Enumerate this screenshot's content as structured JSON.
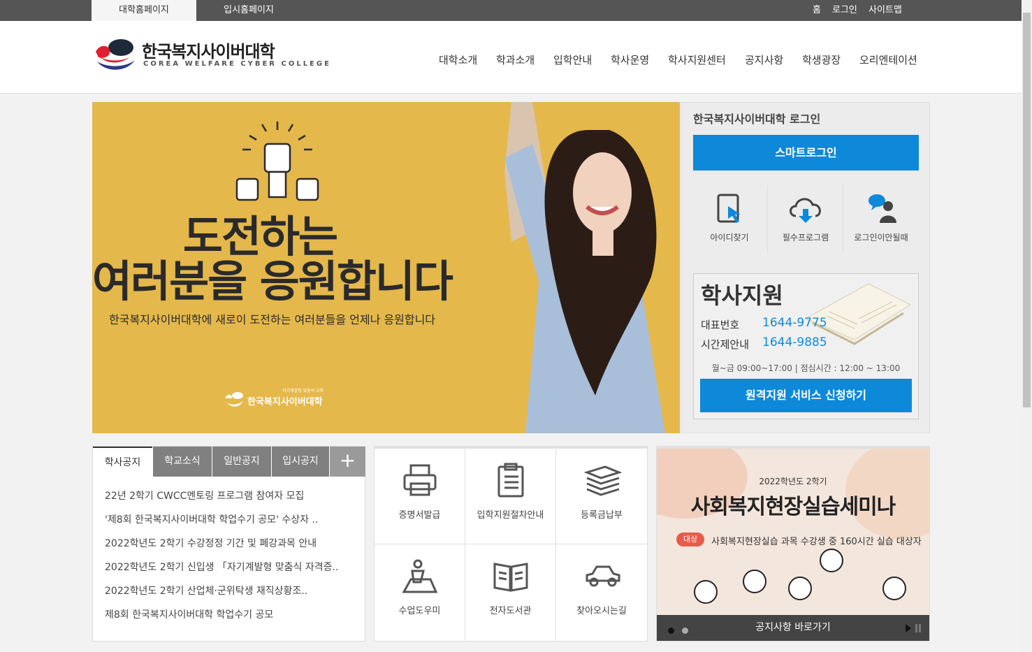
{
  "topbar": {
    "tabs": [
      "대학홈페이지",
      "입시홈페이지"
    ],
    "util": [
      "홈",
      "로그인",
      "사이트맵"
    ]
  },
  "logo": {
    "name_kr": "한국복지사이버대학",
    "name_en": "COREA WELFARE CYBER COLLEGE"
  },
  "gnb": [
    "대학소개",
    "학과소개",
    "입학안내",
    "학사운영",
    "학사지원센터",
    "공지사항",
    "학생광장",
    "오리엔테이션"
  ],
  "hero": {
    "title_line1": "도전하는",
    "title_line2": "여러분을 응원합니다",
    "subtitle": "한국복지사이버대학에 새로이 도전하는 여러분들을 언제나 응원합니다",
    "logo_small": "한국복지사이버대학",
    "logo_tag": "자기계발형 맞춤식 교육"
  },
  "login": {
    "title": "한국복지사이버대학 로그인",
    "smart_login": "스마트로그인",
    "quick": [
      {
        "label": "아이디찾기",
        "icon": "tablet-touch-icon"
      },
      {
        "label": "필수프로그램",
        "icon": "cloud-download-icon"
      },
      {
        "label": "로그인이안될때",
        "icon": "help-person-icon"
      }
    ]
  },
  "support": {
    "title": "학사지원",
    "rows": [
      {
        "label": "대표번호",
        "number": "1644-9775"
      },
      {
        "label": "시간제안내",
        "number": "1644-9885"
      }
    ],
    "hours": "월~금 09:00~17:00 | 점심시간 : 12:00 ~ 13:00",
    "remote_button": "원격지원 서비스 신청하기"
  },
  "notice": {
    "tabs": [
      "학사공지",
      "학교소식",
      "일반공지",
      "입시공지"
    ],
    "plus": "+",
    "items": [
      "22년 2학기 CWCC멘토링 프로그램 참여자 모집",
      "'제8회 한국복지사이버대학 학업수기 공모' 수상자 ..",
      "2022학년도 2학기 수강정정 기간 및 폐강과목 안내",
      "2022학년도 2학기 신입생 「자기계발형 맞춤식 자격증..",
      "2022학년도 2학기 산업체·군위탁생 재직상황조..",
      "제8회 한국복지사이버대학 학업수기 공모"
    ]
  },
  "services": [
    {
      "label": "증명서발급",
      "icon": "printer-icon"
    },
    {
      "label": "입학지원절차안내",
      "icon": "clipboard-list-icon"
    },
    {
      "label": "등록금납부",
      "icon": "stacked-papers-icon"
    },
    {
      "label": "수업도우미",
      "icon": "tutor-person-icon"
    },
    {
      "label": "전자도서관",
      "icon": "open-book-icon"
    },
    {
      "label": "찾아오시는길",
      "icon": "car-icon"
    }
  ],
  "banner": {
    "year": "2022학년도 2학기",
    "title": "사회복지현장실습세미나",
    "target_badge": "대상",
    "target_desc": "사회복지현장실습 과목 수강생 중 160시간 실습 대상자",
    "footer": "공지사항 바로가기"
  },
  "colors": {
    "accent": "#0e89d9",
    "topbar": "#555555",
    "hero_bg": "#e5b84b",
    "badge": "#e85b4a"
  }
}
